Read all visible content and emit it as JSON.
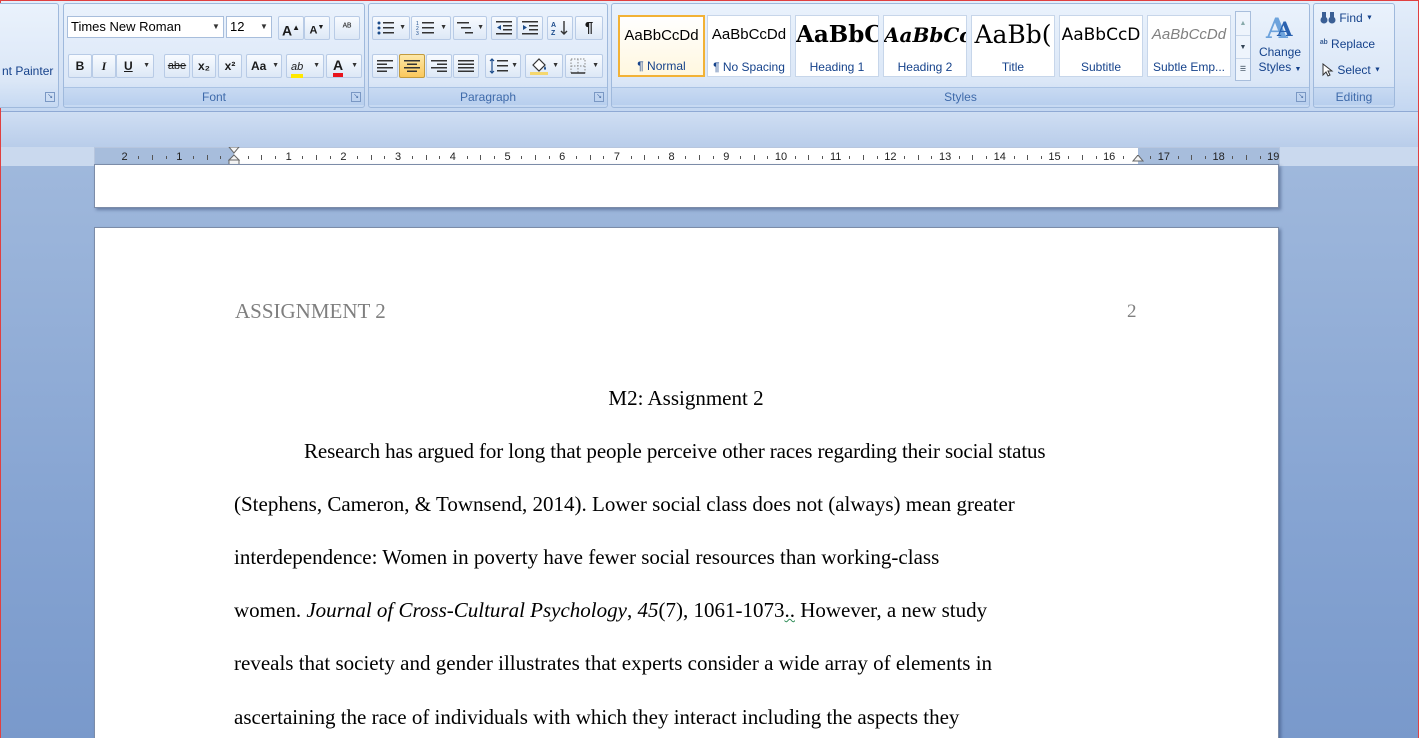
{
  "clipboard": {
    "format_painter_label": "nt Painter"
  },
  "font": {
    "family": "Times New Roman",
    "size": "12",
    "group_label": "Font",
    "grow_label": "A",
    "shrink_label": "A",
    "clear_label": "ᴬᴮ",
    "bold_label": "B",
    "italic_label": "I",
    "underline_label": "U",
    "strike_label": "abe",
    "subscript_label": "x₂",
    "superscript_label": "x²",
    "case_label": "Aa",
    "highlight_label": "ab",
    "color_label": "A"
  },
  "paragraph": {
    "group_label": "Paragraph"
  },
  "styles": {
    "group_label": "Styles",
    "items": [
      {
        "preview": "AaBbCcDd",
        "name": "¶ Normal"
      },
      {
        "preview": "AaBbCcDd",
        "name": "¶ No Spacing"
      },
      {
        "preview": "AaBbC",
        "name": "Heading 1"
      },
      {
        "preview": "AaBbCc",
        "name": "Heading 2"
      },
      {
        "preview": "AaBb(",
        "name": "Title"
      },
      {
        "preview": "AaBbCcD",
        "name": "Subtitle"
      },
      {
        "preview": "AaBbCcDd",
        "name": "Subtle Emp..."
      }
    ],
    "change_label_1": "Change",
    "change_label_2": "Styles"
  },
  "editing": {
    "group_label": "Editing",
    "find_label": "Find",
    "replace_label": "Replace",
    "select_label": "Select"
  },
  "ruler": {
    "left_numbers": [
      "2",
      "1"
    ],
    "right_numbers": [
      "1",
      "2",
      "3",
      "4",
      "5",
      "6",
      "7",
      "8",
      "9",
      "10",
      "11",
      "12",
      "13",
      "14",
      "15",
      "16",
      "17",
      "18",
      "19"
    ]
  },
  "document": {
    "header_title": "ASSIGNMENT 2",
    "page_number": "2",
    "heading": "M2: Assignment 2",
    "lines": [
      "Research has argued for long that people perceive other races regarding their social status",
      "(Stephens, Cameron, & Townsend, 2014). Lower social class does not (always) mean greater",
      "interdependence: Women in poverty have fewer social resources than working-class"
    ],
    "line4": {
      "a": "women. ",
      "journal": "Journal of Cross-Cultural Psychology",
      "comma": ", ",
      "volume": "45",
      "rest": "(7), 1061-1073",
      "dots": "..",
      "tail": " However, a new study"
    },
    "lines_after": [
      "reveals that society and gender illustrates that experts consider a wide array of elements in",
      "ascertaining the race of individuals with which they interact including the aspects they"
    ]
  }
}
